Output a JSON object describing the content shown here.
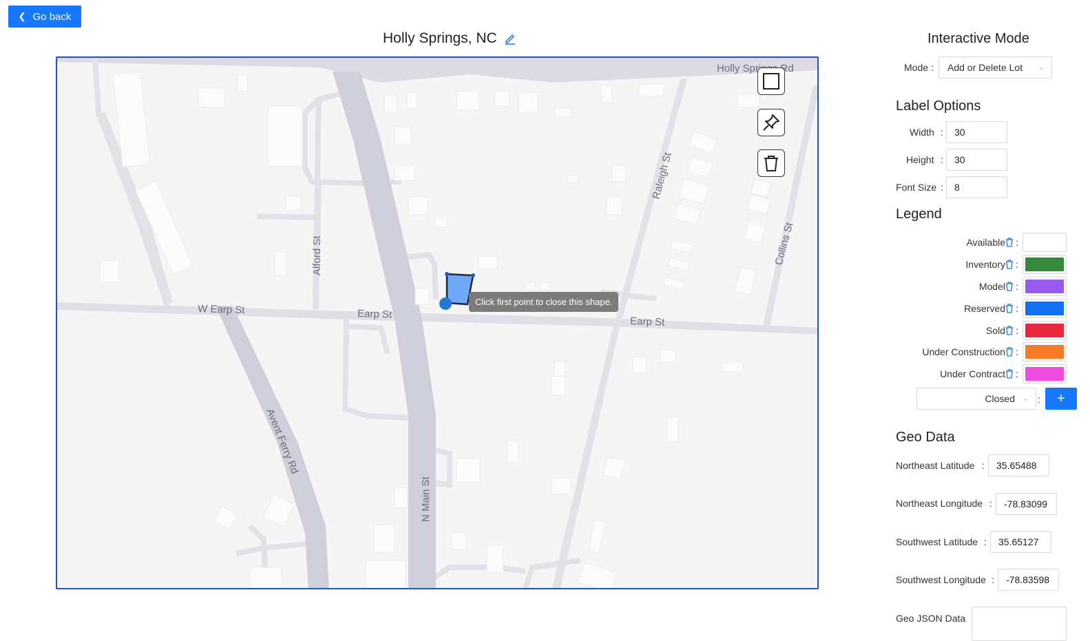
{
  "back_button": {
    "label": "Go back",
    "icon": "chevron-left-icon"
  },
  "page_title": "Holly Springs, NC",
  "map": {
    "streets": [
      "Holly Springs Rd",
      "W Earp St",
      "Earp St",
      "Earp St",
      "Alford St",
      "Raleigh St",
      "Collins St",
      "Avent Ferry Rd",
      "N Main St"
    ],
    "tooltip": "Click first point to close this shape.",
    "tools": [
      "square-icon",
      "pin-icon",
      "trash-icon"
    ],
    "drawing_fill": "#6fa8f7"
  },
  "interactive_mode": {
    "title": "Interactive Mode",
    "mode_label": "Mode",
    "mode_value": "Add or Delete Lot"
  },
  "label_options": {
    "title": "Label Options",
    "width_label": "Width",
    "width_value": "30",
    "height_label": "Height",
    "height_value": "30",
    "font_size_label": "Font Size",
    "font_size_value": "8"
  },
  "legend": {
    "title": "Legend",
    "items": [
      {
        "name": "Available",
        "color": "#ffffff"
      },
      {
        "name": "Inventory",
        "color": "#35893a"
      },
      {
        "name": "Model",
        "color": "#9a5cf0"
      },
      {
        "name": "Reserved",
        "color": "#1071f5"
      },
      {
        "name": "Sold",
        "color": "#e8283f"
      },
      {
        "name": "Under Construction",
        "color": "#f77b24"
      },
      {
        "name": "Under Contract",
        "color": "#f04ce2"
      }
    ],
    "new_status_value": "Closed",
    "add_label": "+"
  },
  "geo_data": {
    "title": "Geo Data",
    "ne_lat_label": "Northeast Latitude",
    "ne_lat_value": "35.65488",
    "ne_lng_label": "Northeast Longitude",
    "ne_lng_value": "-78.83099",
    "sw_lat_label": "Southwest Latitude",
    "sw_lat_value": "35.65127",
    "sw_lng_label": "Southwest Longitude",
    "sw_lng_value": "-78.83598",
    "geojson_label": "Geo JSON Data"
  },
  "colon": ":"
}
